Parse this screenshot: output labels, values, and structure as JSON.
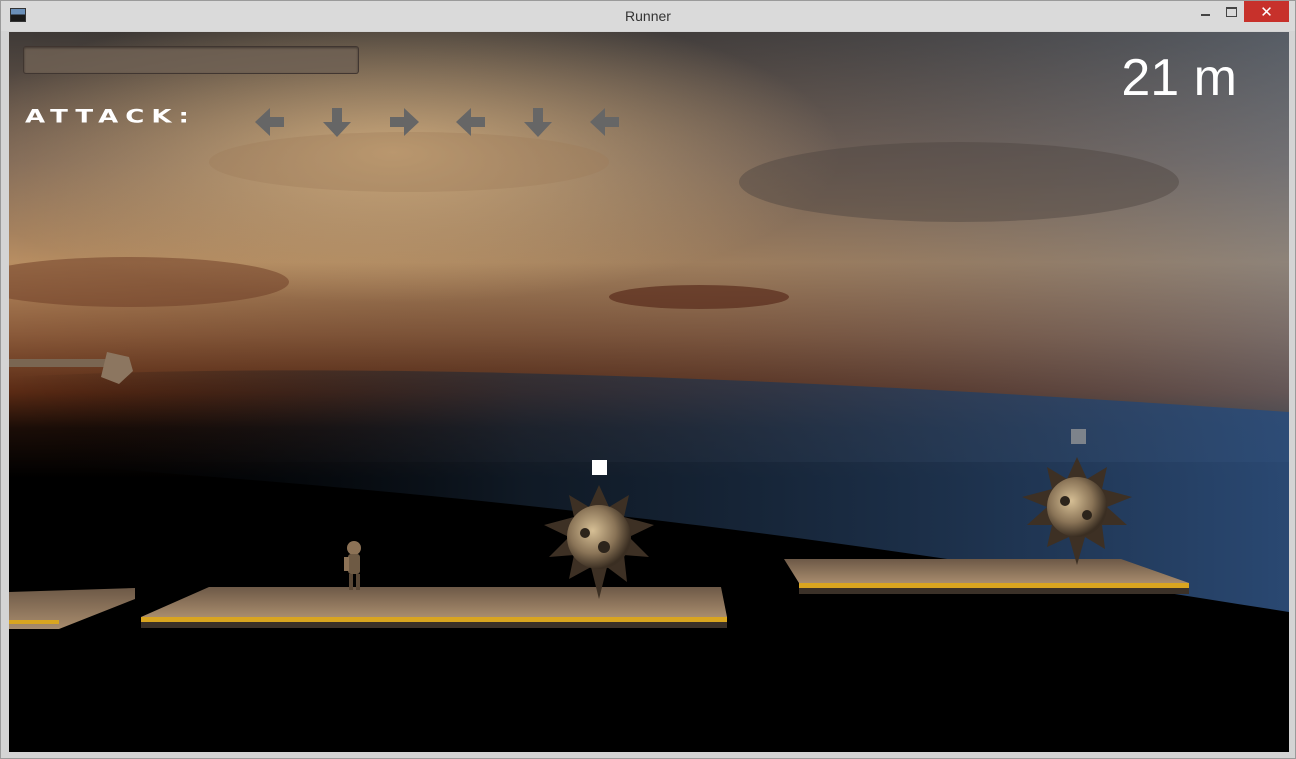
{
  "window": {
    "title": "Runner",
    "icon": "app-icon",
    "controls": {
      "minimize": "minimize-icon",
      "maximize": "maximize-icon",
      "close": "✕"
    }
  },
  "hud": {
    "health_level": 0,
    "attack_label": "ATTACK:",
    "attack_sequence": [
      "left",
      "down",
      "right",
      "left",
      "down",
      "left"
    ],
    "distance": "21 m"
  },
  "colors": {
    "arrow": "#666666",
    "platform": "#8a7460",
    "hazard_stripe": "#d9a520",
    "close_button": "#c7312b"
  }
}
